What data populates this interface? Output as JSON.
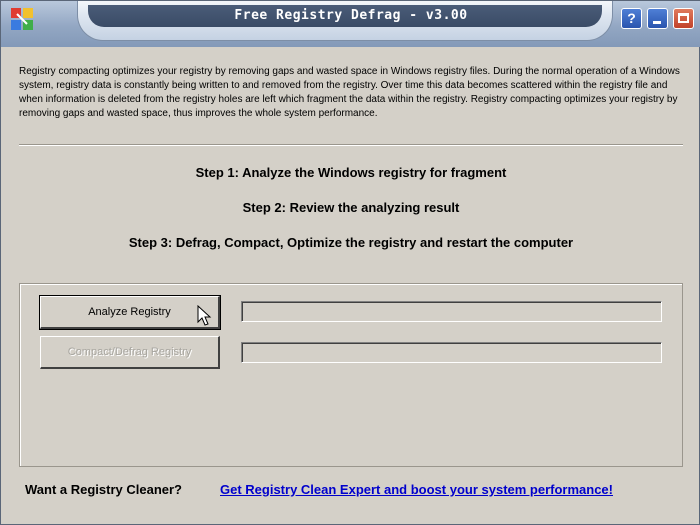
{
  "window": {
    "title": "Free Registry Defrag - v3.00",
    "controls": {
      "help": "?"
    }
  },
  "description": "Registry compacting optimizes your registry by removing gaps and wasted space in Windows registry files. During the normal operation of a Windows system, registry data is constantly being written to and removed from the registry. Over time this data becomes scattered within the registry file and when information is deleted from the registry holes are left which fragment the data within the registry. Registry compacting optimizes your registry by removing gaps and wasted space, thus improves the whole system performance.",
  "steps": [
    "Step 1: Analyze the Windows registry for fragment",
    "Step 2: Review the analyzing result",
    "Step 3: Defrag, Compact, Optimize the registry and restart the computer"
  ],
  "actions": {
    "analyze_label": "Analyze Registry",
    "compact_label": "Compact/Defrag Registry"
  },
  "progress": {
    "analyze": 0,
    "compact": 0
  },
  "footer": {
    "question": "Want a Registry Cleaner?",
    "link": "Get Registry Clean Expert and boost your system performance!"
  },
  "colors": {
    "link": "#0000cc",
    "disabled_text": "#a7a59f",
    "window_bg": "#d4d0c8"
  }
}
